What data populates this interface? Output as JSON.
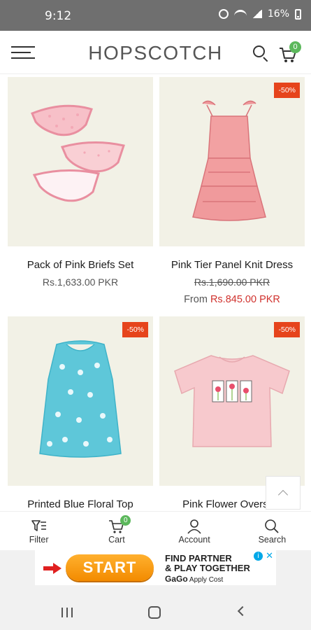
{
  "status_bar": {
    "time": "9:12",
    "battery": "16%"
  },
  "header": {
    "logo": "HOPSCOTCH",
    "cart_count": "0"
  },
  "colors": {
    "sale": "#d0312d",
    "badge": "#e6441c",
    "cart_badge": "#5cb85c",
    "image_bg": "#f2f1e6"
  },
  "products": [
    {
      "name": "Pack of Pink Briefs Set",
      "price": "Rs.1,633.00 PKR",
      "badge": "",
      "image": "pink-briefs-image"
    },
    {
      "name": "Pink Tier Panel Knit Dress",
      "price_old": "Rs.1,690.00 PKR",
      "from_label": "From",
      "price_sale": "Rs.845.00 PKR",
      "badge": "-50%",
      "image": "pink-dress-image"
    },
    {
      "name": "Printed Blue Floral Top",
      "badge": "-50%",
      "image": "blue-floral-top-image"
    },
    {
      "name": "Pink Flower Oversize",
      "badge": "-50%",
      "image": "pink-tshirt-image"
    }
  ],
  "bottom_nav": [
    {
      "label": "Filter",
      "icon": "filter-icon"
    },
    {
      "label": "Cart",
      "icon": "cart-icon",
      "badge": "0"
    },
    {
      "label": "Account",
      "icon": "account-icon"
    },
    {
      "label": "Search",
      "icon": "search-icon"
    }
  ],
  "ad": {
    "button": "START",
    "line1": "FIND PARTNER",
    "line2": "& PLAY TOGETHER",
    "brand": "GaGo",
    "tagline": "Apply Cost"
  }
}
